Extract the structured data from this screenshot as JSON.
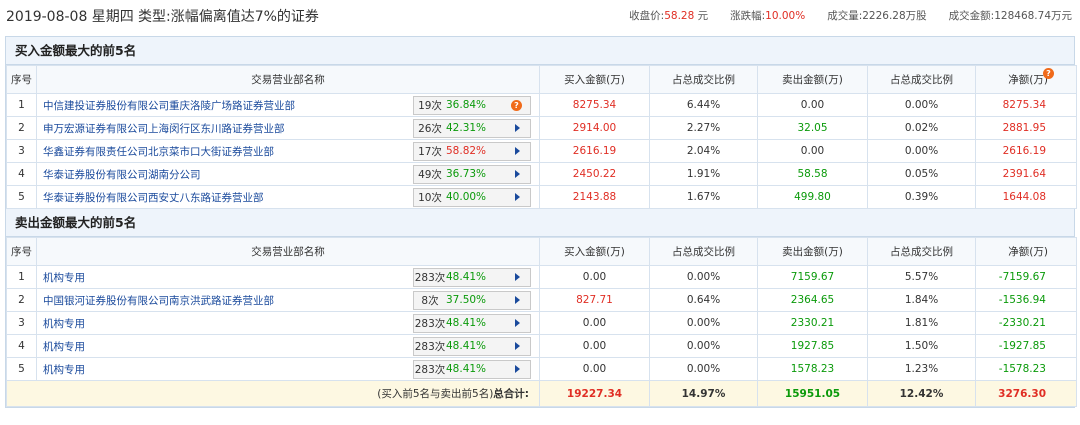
{
  "header": {
    "date": "2019-08-08 星期四",
    "type_label": "类型:",
    "type_value": "涨幅偏离值达7%的证券",
    "close_label": "收盘价:",
    "close_value": "58.28",
    "close_unit": "元",
    "change_label": "涨跌幅:",
    "change_value": "10.00%",
    "volume_label": "成交量:",
    "volume_value": "2226.28万股",
    "amount_label": "成交金额:",
    "amount_value": "128468.74万元"
  },
  "buy_section": {
    "title": "买入金额最大的前5名",
    "columns": [
      "序号",
      "交易营业部名称",
      "买入金额(万)",
      "占总成交比例",
      "卖出金额(万)",
      "占总成交比例",
      "净额(万)"
    ],
    "rows": [
      {
        "idx": "1",
        "name": "中信建投证券股份有限公司重庆洛陵广场路证券营业部",
        "times": "19次",
        "pct": "36.84%",
        "pct_color": "green",
        "buy": "8275.34",
        "buy_ratio": "6.44%",
        "sell": "0.00",
        "sell_ratio": "0.00%",
        "net": "8275.34"
      },
      {
        "idx": "2",
        "name": "申万宏源证券有限公司上海闵行区东川路证券营业部",
        "times": "26次",
        "pct": "42.31%",
        "pct_color": "green",
        "buy": "2914.00",
        "buy_ratio": "2.27%",
        "sell": "32.05",
        "sell_ratio": "0.02%",
        "net": "2881.95"
      },
      {
        "idx": "3",
        "name": "华鑫证券有限责任公司北京菜市口大街证券营业部",
        "times": "17次",
        "pct": "58.82%",
        "pct_color": "red",
        "buy": "2616.19",
        "buy_ratio": "2.04%",
        "sell": "0.00",
        "sell_ratio": "0.00%",
        "net": "2616.19"
      },
      {
        "idx": "4",
        "name": "华泰证券股份有限公司湖南分公司",
        "times": "49次",
        "pct": "36.73%",
        "pct_color": "green",
        "buy": "2450.22",
        "buy_ratio": "1.91%",
        "sell": "58.58",
        "sell_ratio": "0.05%",
        "net": "2391.64"
      },
      {
        "idx": "5",
        "name": "华泰证券股份有限公司西安丈八东路证券营业部",
        "times": "10次",
        "pct": "40.00%",
        "pct_color": "green",
        "buy": "2143.88",
        "buy_ratio": "1.67%",
        "sell": "499.80",
        "sell_ratio": "0.39%",
        "net": "1644.08"
      }
    ]
  },
  "sell_section": {
    "title": "卖出金额最大的前5名",
    "columns": [
      "序号",
      "交易营业部名称",
      "买入金额(万)",
      "占总成交比例",
      "卖出金额(万)",
      "占总成交比例",
      "净额(万)"
    ],
    "rows": [
      {
        "idx": "1",
        "name": "机构专用",
        "times": "283次",
        "pct": "48.41%",
        "pct_color": "green",
        "buy": "0.00",
        "buy_ratio": "0.00%",
        "sell": "7159.67",
        "sell_ratio": "5.57%",
        "net": "-7159.67"
      },
      {
        "idx": "2",
        "name": "中国银河证券股份有限公司南京洪武路证券营业部",
        "times": "8次",
        "pct": "37.50%",
        "pct_color": "green",
        "buy": "827.71",
        "buy_ratio": "0.64%",
        "sell": "2364.65",
        "sell_ratio": "1.84%",
        "net": "-1536.94"
      },
      {
        "idx": "3",
        "name": "机构专用",
        "times": "283次",
        "pct": "48.41%",
        "pct_color": "green",
        "buy": "0.00",
        "buy_ratio": "0.00%",
        "sell": "2330.21",
        "sell_ratio": "1.81%",
        "net": "-2330.21"
      },
      {
        "idx": "4",
        "name": "机构专用",
        "times": "283次",
        "pct": "48.41%",
        "pct_color": "green",
        "buy": "0.00",
        "buy_ratio": "0.00%",
        "sell": "1927.85",
        "sell_ratio": "1.50%",
        "net": "-1927.85"
      },
      {
        "idx": "5",
        "name": "机构专用",
        "times": "283次",
        "pct": "48.41%",
        "pct_color": "green",
        "buy": "0.00",
        "buy_ratio": "0.00%",
        "sell": "1578.23",
        "sell_ratio": "1.23%",
        "net": "-1578.23"
      }
    ]
  },
  "total": {
    "label_prefix": "(买入前5名与卖出前5名)",
    "label_bold": "总合计:",
    "buy": "19227.34",
    "buy_ratio": "14.97%",
    "sell": "15951.05",
    "sell_ratio": "12.42%",
    "net": "3276.30"
  },
  "icons": {
    "badge_icon": "question-badge-icon",
    "expand_icon": "triangle-right-icon"
  },
  "colors": {
    "up": "#e02e24",
    "down": "#0a9a0a",
    "link": "#1a4a9c",
    "badge": "#f06a1a"
  }
}
